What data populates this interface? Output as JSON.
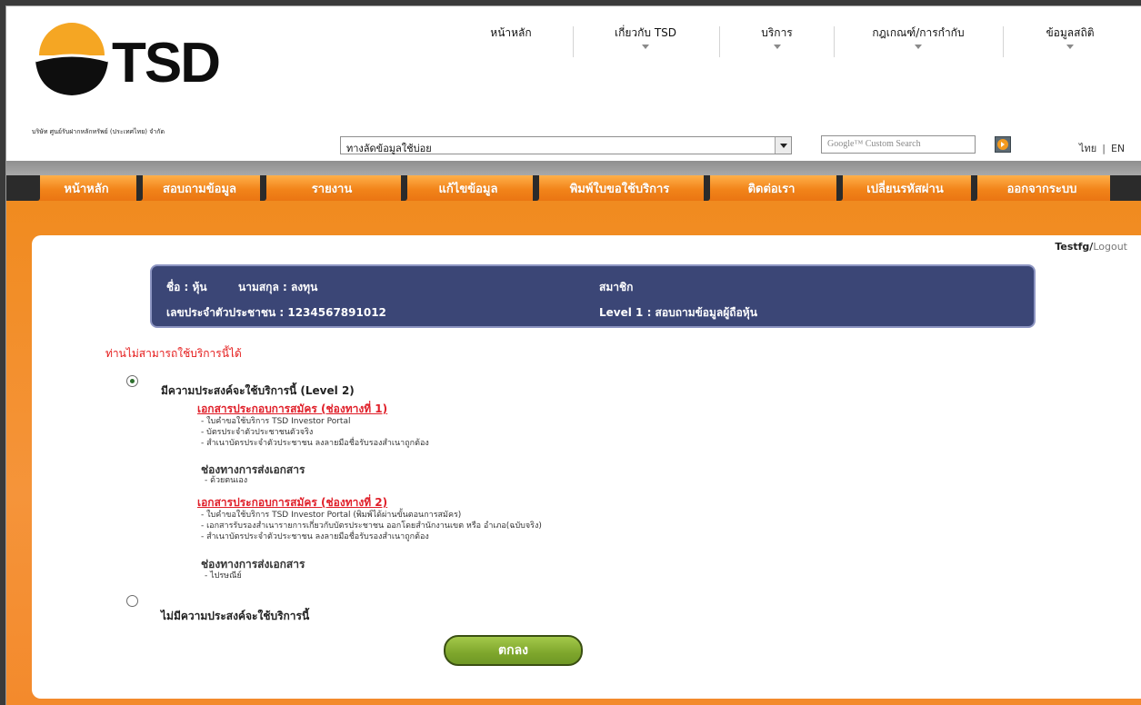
{
  "header": {
    "logo_text": "TSD",
    "company_name": "บริษัท ศูนย์รับฝากหลักทรัพย์ (ประเทศไทย) จำกัด",
    "topnav": [
      {
        "label": "หน้าหลัก",
        "has_dropdown": false
      },
      {
        "label": "เกี่ยวกับ TSD",
        "has_dropdown": true
      },
      {
        "label": "บริการ",
        "has_dropdown": true
      },
      {
        "label": "กฎเกณฑ์/การกำกับ",
        "has_dropdown": true
      },
      {
        "label": "ข้อมูลสถิติ",
        "has_dropdown": true
      }
    ],
    "quicklinks_value": "ทางลัดข้อมูลใช้บ่อย",
    "search_placeholder": "Google™ Custom Search",
    "lang_th": "ไทย",
    "lang_en": "EN"
  },
  "main_tabs": [
    {
      "label": "หน้าหลัก"
    },
    {
      "label": "สอบถามข้อมูล"
    },
    {
      "label": "รายงาน"
    },
    {
      "label": "แก้ไขข้อมูล"
    },
    {
      "label": "พิมพ์ใบขอใช้บริการ"
    },
    {
      "label": "ติดต่อเรา"
    },
    {
      "label": "เปลี่ยนรหัสผ่าน"
    },
    {
      "label": "ออกจากระบบ"
    }
  ],
  "user": {
    "name": "Testfg",
    "slash": "/",
    "logout": "Logout"
  },
  "member": {
    "first_name": "ชื่อ : หุ้น",
    "last_name": "นามสกุล : ลงทุน",
    "member_type": "สมาชิก",
    "id_line": "เลขประจำตัวประชาชน : 1234567891012",
    "level_line": "Level 1  :  สอบถามข้อมูลผู้ถือหุ้น"
  },
  "notice": "ท่านไม่สามารถใช้บริการนี้ได้",
  "options": [
    {
      "label": "มีความประสงค์จะใช้บริการนี้ (Level 2)",
      "selected": true
    },
    {
      "label": "ไม่มีความประสงค์จะใช้บริการนี้",
      "selected": false
    }
  ],
  "channel1": {
    "heading": "เอกสารประกอบการสมัคร (ช่องทางที่ 1)",
    "items": [
      "- ใบคำขอใช้บริการ TSD Investor Portal",
      "- บัตรประจำตัวประชาชนตัวจริง",
      "- สำเนาบัตรประจำตัวประชาชน ลงลายมือชื่อรับรองสำเนาถูกต้อง"
    ],
    "send_heading": "ช่องทางการส่งเอกสาร",
    "send_items": [
      "- ด้วยตนเอง"
    ]
  },
  "channel2": {
    "heading": "เอกสารประกอบการสมัคร (ช่องทางที่ 2)",
    "items": [
      "- ใบคำขอใช้บริการ TSD Investor Portal (พิมพ์ได้ผ่านขั้นตอนการสมัคร)",
      "- เอกสารรับรองสำเนารายการเกี่ยวกับบัตรประชาชน ออกโดยสำนักงานเขต หรือ อำเภอ(ฉบับจริง)",
      "- สำเนาบัตรประจำตัวประชาชน ลงลายมือชื่อรับรองสำเนาถูกต้อง"
    ],
    "send_heading": "ช่องทางการส่งเอกสาร",
    "send_items": [
      "- ไปรษณีย์"
    ]
  },
  "ok_button": "ตกลง",
  "colors": {
    "orange": "#f08a1d",
    "member_box": "#3b4676",
    "notice_red": "#e51b1b",
    "ok_green": "#7ea62c",
    "logo_orange": "#f5a623"
  }
}
